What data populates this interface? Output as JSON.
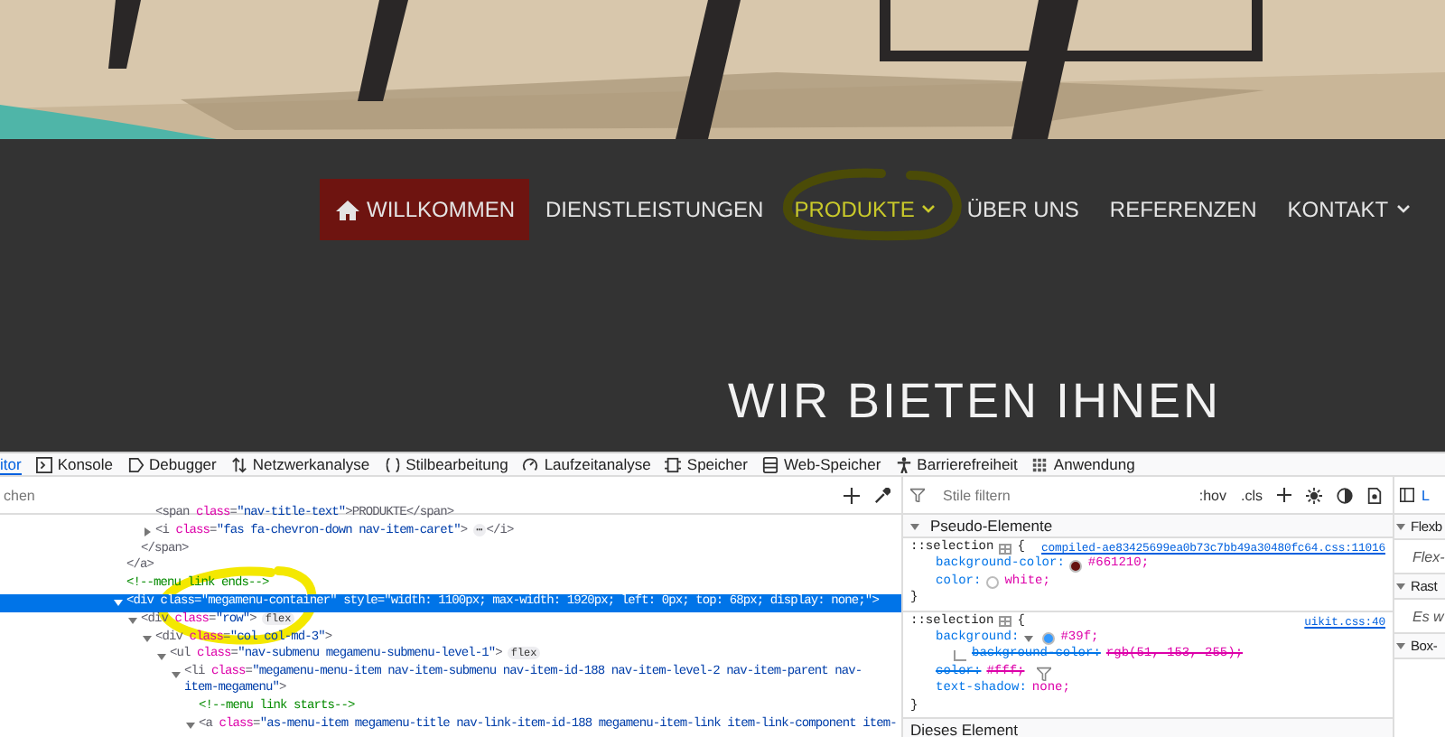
{
  "nav": {
    "items": [
      {
        "label": "WILLKOMMEN",
        "selected": true,
        "highlighted": false,
        "dropdown": false
      },
      {
        "label": "DIENSTLEISTUNGEN",
        "selected": false,
        "highlighted": false,
        "dropdown": false
      },
      {
        "label": "PRODUKTE",
        "selected": false,
        "highlighted": true,
        "dropdown": true
      },
      {
        "label": "ÜBER UNS",
        "selected": false,
        "highlighted": false,
        "dropdown": false
      },
      {
        "label": "REFERENZEN",
        "selected": false,
        "highlighted": false,
        "dropdown": false
      },
      {
        "label": "KONTAKT",
        "selected": false,
        "highlighted": false,
        "dropdown": true
      }
    ]
  },
  "heading": "WIR BIETEN IHNEN",
  "devtools": {
    "tabs": [
      {
        "label": "itor",
        "selected": true
      },
      {
        "label": "Konsole",
        "selected": false
      },
      {
        "label": "Debugger",
        "selected": false
      },
      {
        "label": "Netzwerkanalyse",
        "selected": false
      },
      {
        "label": "Stilbearbeitung",
        "selected": false
      },
      {
        "label": "Laufzeitanalyse",
        "selected": false
      },
      {
        "label": "Speicher",
        "selected": false
      },
      {
        "label": "Web-Speicher",
        "selected": false
      },
      {
        "label": "Barrierefreiheit",
        "selected": false
      },
      {
        "label": "Anwendung",
        "selected": false
      }
    ],
    "search": {
      "placeholder": "chen"
    },
    "markup": [
      {
        "children": [
          {
            "children": [
              {
                "tokens": [
                  {
                    "kind": "tag",
                    "text": "<span"
                  },
                  {
                    "kind": "attr",
                    "text": "class"
                  },
                  {
                    "kind": "tag",
                    "text": "="
                  },
                  {
                    "kind": "value",
                    "text": "\"nav-title-text\""
                  },
                  {
                    "kind": "tag",
                    "text": ">PRODUKTE</span>"
                  }
                ]
              },
              {
                "expanded": false,
                "tokens": [
                  {
                    "kind": "tag",
                    "text": "<i"
                  },
                  {
                    "kind": "attr",
                    "text": "class"
                  },
                  {
                    "kind": "tag",
                    "text": "="
                  },
                  {
                    "kind": "value",
                    "text": "\"fas fa-chevron-down nav-item-caret\""
                  },
                  {
                    "kind": "tag",
                    "text": ">"
                  },
                  {
                    "kind": "more",
                    "text": "⋯"
                  },
                  {
                    "kind": "tag",
                    "text": "</i>"
                  }
                ]
              }
            ]
          },
          {
            "tokens": [
              {
                "kind": "tag",
                "text": "</span>"
              }
            ]
          }
        ]
      },
      {
        "tokens": [
          {
            "kind": "tag",
            "text": "</a>"
          }
        ]
      },
      {
        "tokens": [
          {
            "kind": "comment",
            "text": "<!--menu link ends-->"
          }
        ]
      },
      {
        "expanded": true,
        "selected": true,
        "tokens": [
          {
            "kind": "tag",
            "text": "<div"
          },
          {
            "kind": "attr",
            "text": "class"
          },
          {
            "kind": "tag",
            "text": "="
          },
          {
            "kind": "value",
            "text": "\"megamenu-container\""
          },
          {
            "kind": "attr",
            "text": "style"
          },
          {
            "kind": "tag",
            "text": "="
          },
          {
            "kind": "value",
            "text": "\"width: 1100px; max-width: 1920px; left: 0px; top: 68px; display: none;\""
          },
          {
            "kind": "tag",
            "text": ">"
          }
        ],
        "children": [
          {
            "expanded": true,
            "tokens": [
              {
                "kind": "tag",
                "text": "<div"
              },
              {
                "kind": "attr",
                "text": "class"
              },
              {
                "kind": "tag",
                "text": "="
              },
              {
                "kind": "value",
                "text": "\"row\""
              },
              {
                "kind": "tag",
                "text": ">"
              },
              {
                "kind": "badge",
                "text": "flex"
              }
            ],
            "children": [
              {
                "expanded": true,
                "tokens": [
                  {
                    "kind": "tag",
                    "text": "<div"
                  },
                  {
                    "kind": "attr",
                    "text": "class"
                  },
                  {
                    "kind": "tag",
                    "text": "="
                  },
                  {
                    "kind": "value",
                    "text": "\"col col-md-3\""
                  },
                  {
                    "kind": "tag",
                    "text": ">"
                  }
                ],
                "children": [
                  {
                    "expanded": true,
                    "tokens": [
                      {
                        "kind": "tag",
                        "text": "<ul"
                      },
                      {
                        "kind": "attr",
                        "text": "class"
                      },
                      {
                        "kind": "tag",
                        "text": "="
                      },
                      {
                        "kind": "value",
                        "text": "\"nav-submenu megamenu-submenu-level-1\""
                      },
                      {
                        "kind": "tag",
                        "text": ">"
                      },
                      {
                        "kind": "badge",
                        "text": "flex"
                      }
                    ],
                    "children": [
                      {
                        "expanded": true,
                        "tokens": [
                          {
                            "kind": "tag",
                            "text": "<li"
                          },
                          {
                            "kind": "attr",
                            "text": "class"
                          },
                          {
                            "kind": "tag",
                            "text": "="
                          },
                          {
                            "kind": "value",
                            "text": "\"megamenu-menu-item nav-item-submenu nav-item-id-188 nav-item-level-2 nav-item-parent nav-item-megamenu\""
                          },
                          {
                            "kind": "tag",
                            "text": ">"
                          }
                        ],
                        "children": [
                          {
                            "tokens": [
                              {
                                "kind": "comment",
                                "text": "<!--menu link starts-->"
                              }
                            ]
                          },
                          {
                            "expanded": true,
                            "tokens": [
                              {
                                "kind": "tag",
                                "text": "<a"
                              },
                              {
                                "kind": "attr",
                                "text": "class"
                              },
                              {
                                "kind": "tag",
                                "text": "="
                              },
                              {
                                "kind": "value",
                                "text": "\"as-menu-item megamenu-title nav-link-item-id-188 megamenu-item-link item-link-component item-"
                              }
                            ]
                          }
                        ]
                      }
                    ]
                  }
                ]
              }
            ]
          }
        ]
      }
    ],
    "filter": {
      "placeholder": "Stile filtern"
    },
    "rule_tools": [
      ":hov",
      ".cls"
    ],
    "pseudo_header": "Pseudo-Elemente",
    "rules": [
      {
        "selector": "::selection",
        "open": "{",
        "close": "}",
        "source": "compiled-ae83425699ea0b73c7bb49a30480fc64.css:11016",
        "decls": [
          {
            "name": "background-color:",
            "value": "#661210;",
            "color": "#661210",
            "overridden": false
          },
          {
            "name": "color:",
            "value": "white;",
            "color": "#ffffff",
            "overridden": false
          }
        ]
      },
      {
        "selector": "::selection",
        "open": "{",
        "close": "}",
        "source": "uikit.css:40",
        "decls": [
          {
            "name": "background:",
            "value": "#39f;",
            "color": "#3399ff",
            "overridden": false,
            "expanded": true,
            "children": [
              {
                "name": "background-color:",
                "value": "rgb(51, 153, 255);",
                "overridden": true
              }
            ]
          },
          {
            "name": "color:",
            "value": "#fff;",
            "overridden": true,
            "filter": true
          },
          {
            "name": "text-shadow:",
            "value": "none;",
            "overridden": false
          }
        ]
      }
    ],
    "element_header": "Dieses Element",
    "side": {
      "tab": "L",
      "sections": [
        {
          "title": "Flexb",
          "note": "Flex-"
        },
        {
          "title": "Rast",
          "note": "Es w"
        },
        {
          "title": "Box-"
        }
      ]
    }
  }
}
